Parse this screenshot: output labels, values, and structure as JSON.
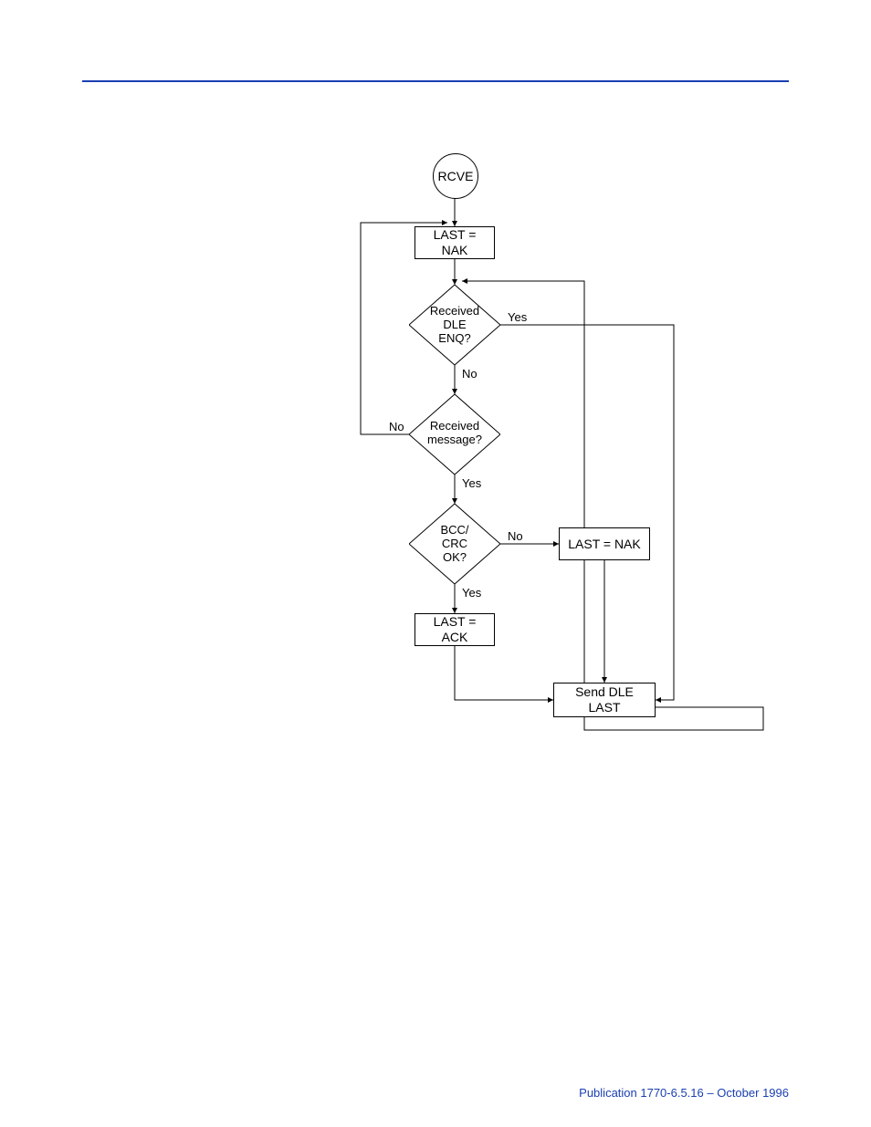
{
  "chart_data": {
    "type": "flowchart",
    "start": "RCVE",
    "nodes": [
      {
        "id": "rcve",
        "kind": "terminator",
        "label": "RCVE"
      },
      {
        "id": "nak1",
        "kind": "process",
        "label": "LAST = NAK"
      },
      {
        "id": "d_enq",
        "kind": "decision",
        "label": "Received\nDLE\nENQ?"
      },
      {
        "id": "d_msg",
        "kind": "decision",
        "label": "Received\nmessage?"
      },
      {
        "id": "d_crc",
        "kind": "decision",
        "label": "BCC/\nCRC\nOK?"
      },
      {
        "id": "nak2",
        "kind": "process",
        "label": "LAST = NAK"
      },
      {
        "id": "ack",
        "kind": "process",
        "label": "LAST = ACK"
      },
      {
        "id": "send",
        "kind": "process",
        "label": "Send DLE LAST"
      }
    ],
    "edges": [
      {
        "from": "rcve",
        "to": "nak1"
      },
      {
        "from": "nak1",
        "to": "d_enq"
      },
      {
        "from": "d_enq",
        "to": "send",
        "label": "Yes"
      },
      {
        "from": "d_enq",
        "to": "d_msg",
        "label": "No"
      },
      {
        "from": "d_msg",
        "to": "nak1",
        "label": "No"
      },
      {
        "from": "d_msg",
        "to": "d_crc",
        "label": "Yes"
      },
      {
        "from": "d_crc",
        "to": "nak2",
        "label": "No"
      },
      {
        "from": "d_crc",
        "to": "ack",
        "label": "Yes"
      },
      {
        "from": "nak2",
        "to": "send"
      },
      {
        "from": "ack",
        "to": "send"
      },
      {
        "from": "send",
        "to": "d_enq"
      }
    ]
  },
  "labels": {
    "yes": "Yes",
    "no": "No"
  },
  "footer": "Publication 1770-6.5.16 – October 1996"
}
